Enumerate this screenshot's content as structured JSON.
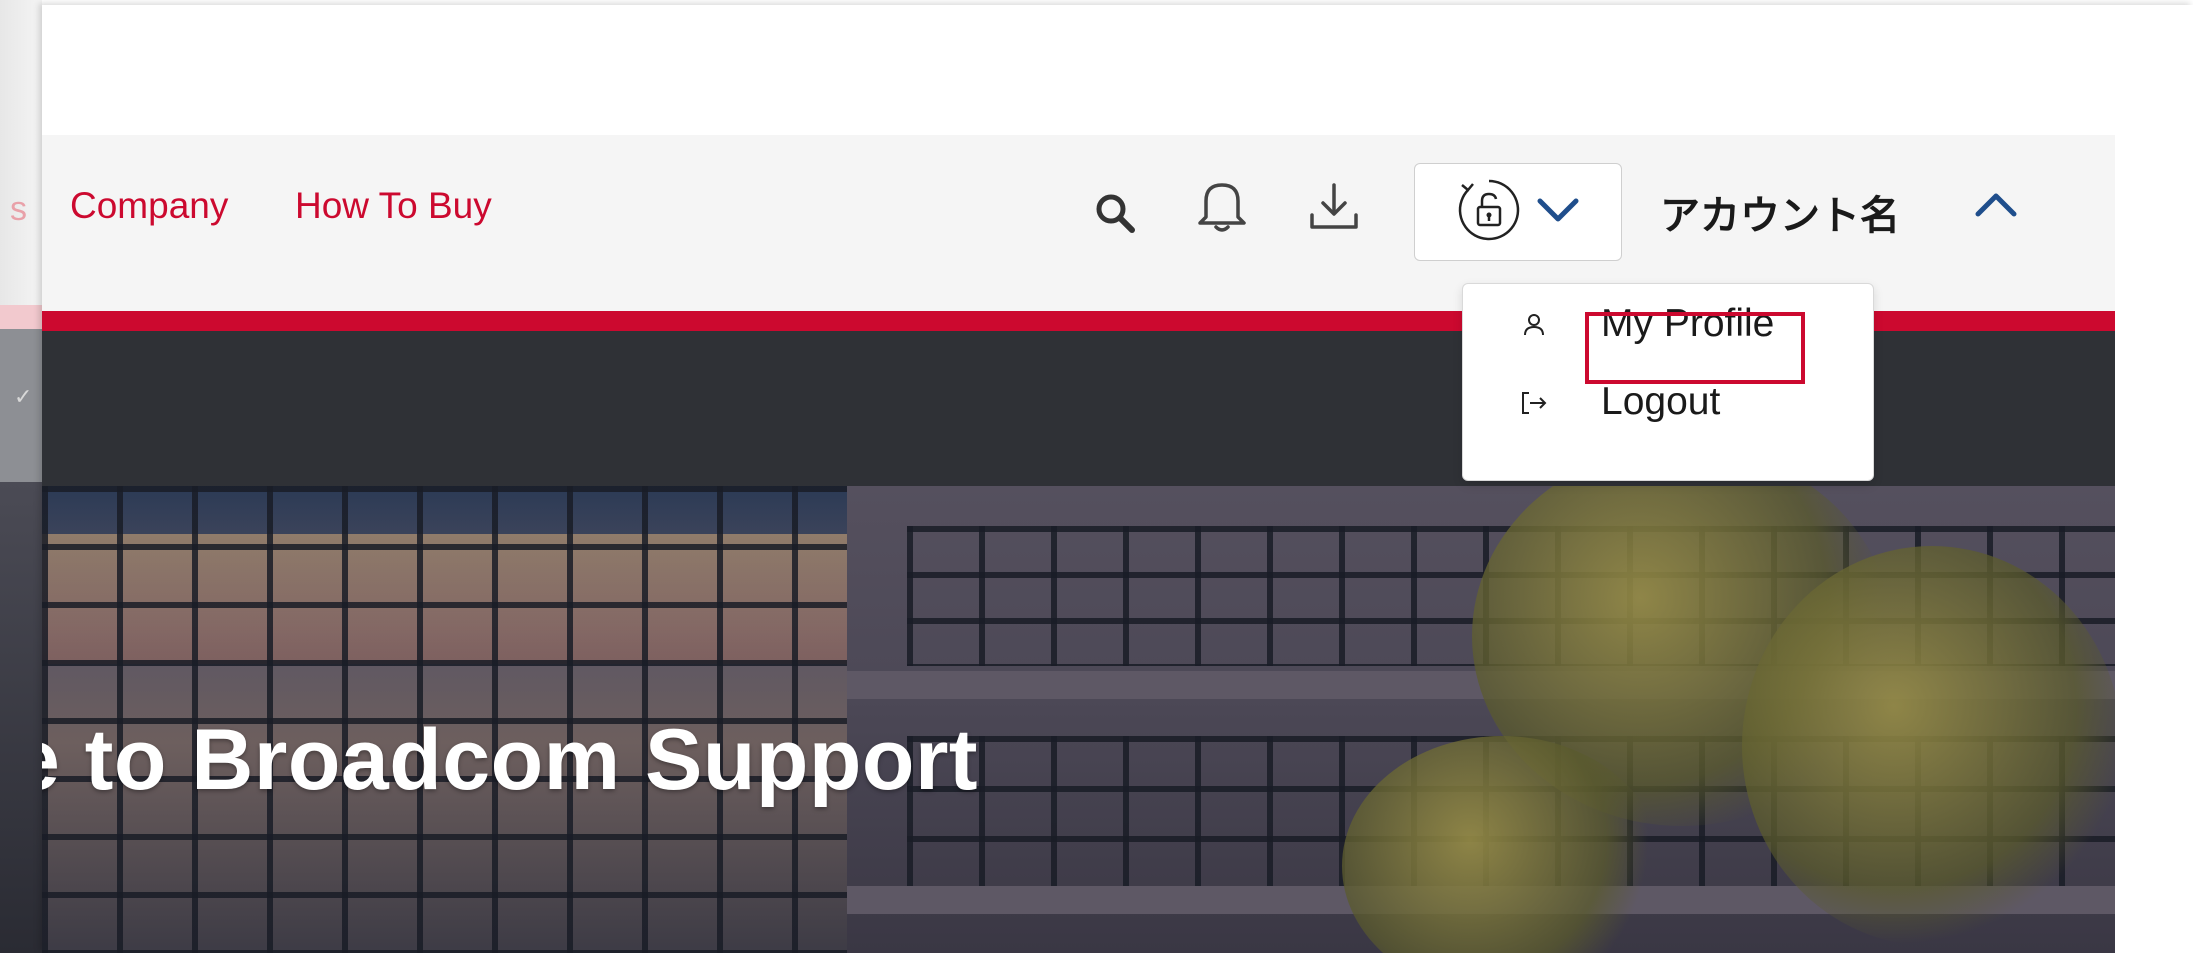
{
  "nav": {
    "partial_prev": "s",
    "links": [
      "Company",
      "How To Buy"
    ]
  },
  "icons": {
    "search": "search-icon",
    "notifications": "bell-icon",
    "downloads": "download-icon",
    "lock": "unlock-icon",
    "lock_chevron": "chevron-down-icon",
    "account_chevron": "chevron-up-icon"
  },
  "account": {
    "name": "アカウント名"
  },
  "dropdown": {
    "items": [
      {
        "label": "My Profile",
        "icon": "user-icon"
      },
      {
        "label": "Logout",
        "icon": "logout-icon"
      }
    ]
  },
  "hero": {
    "title": "e to Broadcom Support"
  },
  "colors": {
    "brand_red": "#cc092f",
    "nav_bg": "#f5f5f5",
    "dark_band": "#2f3136",
    "chevron_blue": "#1f4e8c"
  }
}
